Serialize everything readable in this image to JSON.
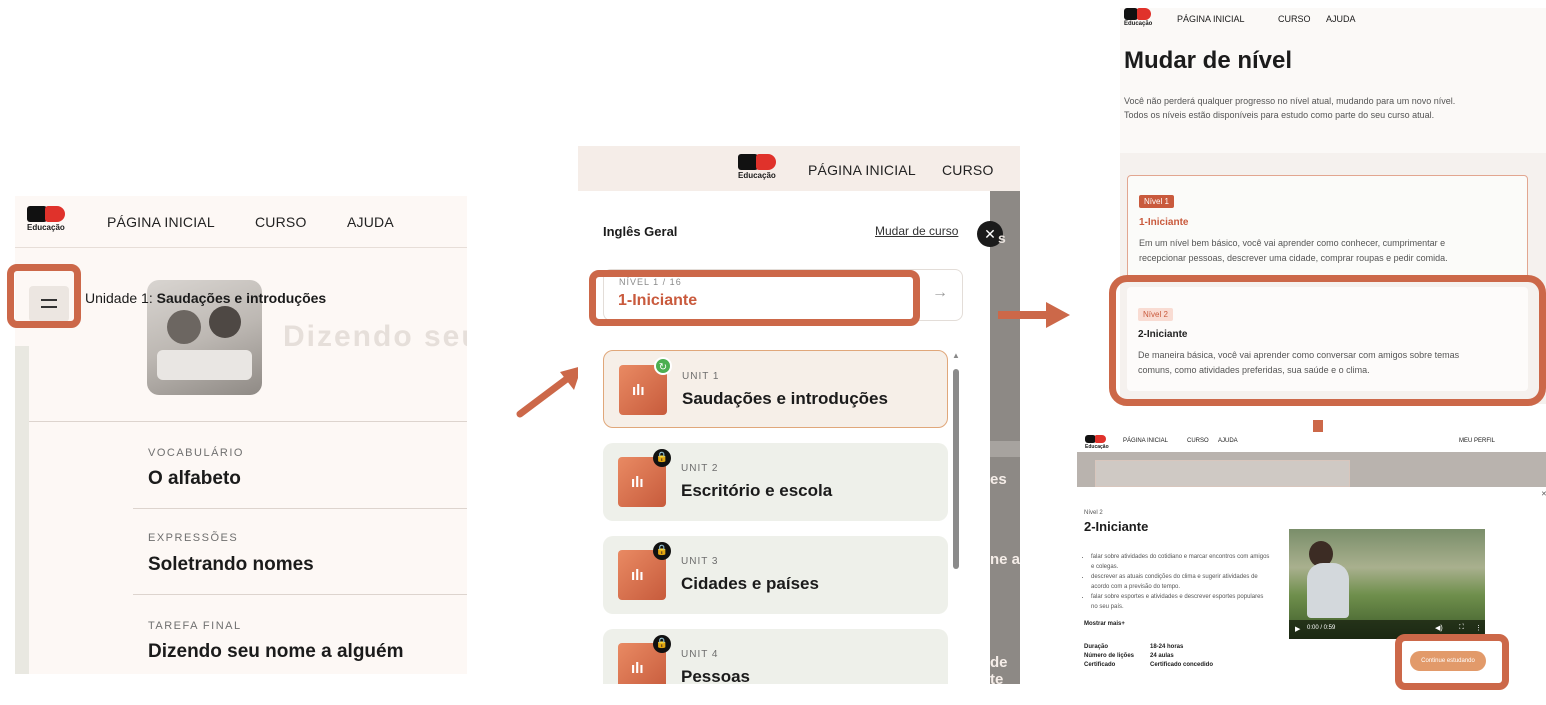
{
  "logo": {
    "text": "Educação"
  },
  "panel1": {
    "nav": [
      "PÁGINA INICIAL",
      "CURSO",
      "AJUDA"
    ],
    "unit_prefix": "Unidade 1:",
    "unit_name": "Saudações e introduções",
    "hero_text": "Dizendo seu",
    "lessons": [
      {
        "category": "VOCABULÁRIO",
        "title": "O alfabeto"
      },
      {
        "category": "EXPRESSÕES",
        "title": "Soletrando nomes"
      },
      {
        "category": "TAREFA FINAL",
        "title": "Dizendo seu nome a alguém"
      }
    ]
  },
  "panel2": {
    "nav": [
      "PÁGINA INICIAL",
      "CURSO"
    ],
    "course": "Inglês Geral",
    "change_course": "Mudar de curso",
    "level_label": "NÍVEL 1 / 16",
    "level_name": "1-Iniciante",
    "units": [
      {
        "label": "UNIT 1",
        "title": "Saudações e introduções",
        "status": "in-progress"
      },
      {
        "label": "UNIT 2",
        "title": "Escritório e escola",
        "status": "locked"
      },
      {
        "label": "UNIT 3",
        "title": "Cidades e países",
        "status": "locked"
      },
      {
        "label": "UNIT 4",
        "title": "Pessoas",
        "status": "locked"
      }
    ],
    "side_texts": [
      "s",
      "es",
      "ne a",
      "de te"
    ]
  },
  "panel3": {
    "nav": [
      "PÁGINA INICIAL",
      "CURSO",
      "AJUDA"
    ],
    "title": "Mudar de nível",
    "desc1": "Você não perderá qualquer progresso no nível atual, mudando para um novo nível.",
    "desc2": "Todos os níveis estão disponíveis para estudo como parte do seu curso atual.",
    "levels": [
      {
        "tag": "Nível 1",
        "name": "1-Iniciante",
        "desc1": "Em um nível bem básico, você vai aprender como conhecer, cumprimentar e",
        "desc2": "recepcionar pessoas, descrever uma cidade, comprar roupas e pedir comida."
      },
      {
        "tag": "Nível 2",
        "name": "2-Iniciante",
        "desc1": "De maneira básica, você vai aprender como conversar com amigos sobre temas",
        "desc2": "comuns, como atividades preferidas, sua saúde e o clima."
      }
    ]
  },
  "panel4": {
    "nav": [
      "PÁGINA INICIAL",
      "CURSO",
      "AJUDA"
    ],
    "profile": "MEU PERFIL",
    "tag": "Nível 2",
    "title": "2-Iniciante",
    "bullets": [
      "falar sobre atividades do cotidiano e marcar encontros com amigos e colegas.",
      "descrever as atuais condições do clima e sugerir atividades de acordo com a previsão do tempo.",
      "falar sobre esportes e atividades e descrever esportes populares no seu país."
    ],
    "show_more": "Mostrar mais+",
    "details": [
      {
        "k": "Duração",
        "v": "18-24 horas"
      },
      {
        "k": "Número de lições",
        "v": "24 aulas"
      },
      {
        "k": "Certificado",
        "v": "Certificado concedido"
      }
    ],
    "video_time": "0:00 / 0:59",
    "continue": "Continue estudando"
  },
  "colors": {
    "accent": "#cc6849",
    "brand_red": "#e0322b",
    "level_red": "#c95a3d"
  }
}
